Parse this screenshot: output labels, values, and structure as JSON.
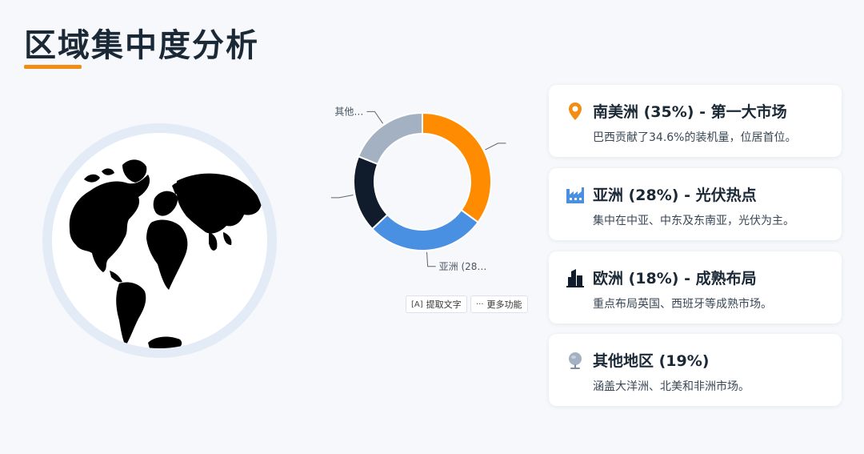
{
  "page": {
    "title": "区域集中度分析"
  },
  "chart_data": {
    "type": "pie",
    "donut": true,
    "slices": [
      {
        "name": "南美洲",
        "value": 35,
        "color": "#FF8C00"
      },
      {
        "name": "亚洲",
        "value": 28,
        "color": "#4A90E2"
      },
      {
        "name": "欧洲",
        "value": 18,
        "color": "#101C2C"
      },
      {
        "name": "其他地区",
        "value": 19,
        "color": "#A3B1C2"
      }
    ],
    "visible_labels": {
      "asia": "亚洲 (28…",
      "other": "其他…"
    }
  },
  "toolbar": {
    "extract_text": "提取文字",
    "more": "更多功能"
  },
  "cards": [
    {
      "title": "南美洲 (35%) - 第一大市场",
      "desc": "巴西贡献了34.6%的装机量，位居首位。",
      "icon": "map-pin-icon",
      "color": "#F28C13"
    },
    {
      "title": "亚洲 (28%) - 光伏热点",
      "desc": "集中在中亚、中东及东南亚，光伏为主。",
      "icon": "factory-icon",
      "color": "#4A90E2"
    },
    {
      "title": "欧洲 (18%) - 成熟布局",
      "desc": "重点布局英国、西班牙等成熟市场。",
      "icon": "building-icon",
      "color": "#101C2C"
    },
    {
      "title": "其他地区 (19%)",
      "desc": "涵盖大洋洲、北美和非洲市场。",
      "icon": "globe-icon",
      "color": "#A3B1C2"
    }
  ]
}
